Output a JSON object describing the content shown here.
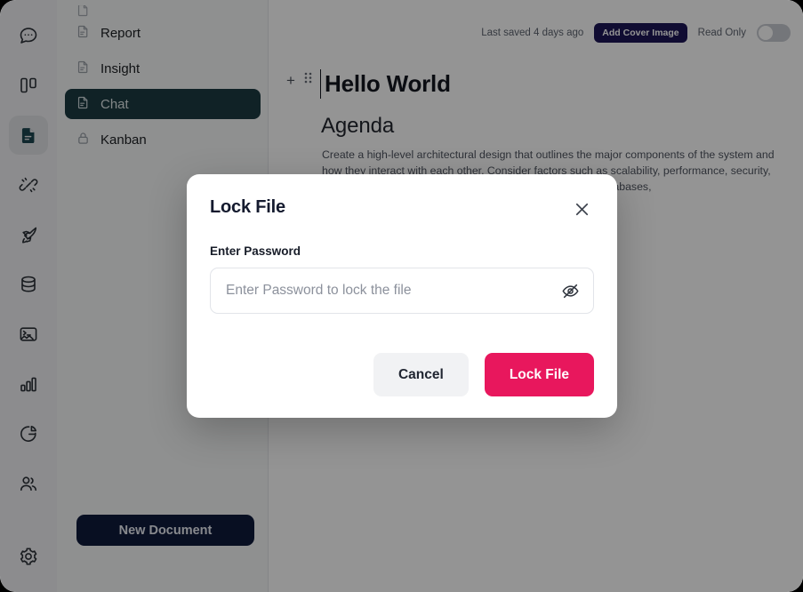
{
  "colors": {
    "accent_pink": "#E8175D",
    "sidebar_active_teal": "#1D3B43",
    "new_document_navy": "#0E1A3C",
    "add_cover_navy": "#1C1557",
    "rail_background": "#F1F2F4",
    "sidebar_background": "#F7F8F9"
  },
  "rail": {
    "items": [
      {
        "icon": "chat-bubble-icon",
        "active": false
      },
      {
        "icon": "columns-layout-icon",
        "active": false
      },
      {
        "icon": "document-icon",
        "active": true
      },
      {
        "icon": "plug-connection-icon",
        "active": false
      },
      {
        "icon": "rocket-icon",
        "active": false
      },
      {
        "icon": "database-icon",
        "active": false
      },
      {
        "icon": "terminal-image-icon",
        "active": false
      },
      {
        "icon": "bar-chart-icon",
        "active": false
      },
      {
        "icon": "pie-chart-icon",
        "active": false
      },
      {
        "icon": "users-icon",
        "active": false
      },
      {
        "icon": "gear-icon",
        "active": false
      }
    ]
  },
  "sidebar": {
    "items": [
      {
        "label": "Report",
        "icon": "document-icon",
        "active": false,
        "locked": false
      },
      {
        "label": "Insight",
        "icon": "document-icon",
        "active": false,
        "locked": false
      },
      {
        "label": "Chat",
        "icon": "document-icon",
        "active": true,
        "locked": false
      },
      {
        "label": "Kanban",
        "icon": "lock-icon",
        "active": false,
        "locked": true
      }
    ],
    "new_document_label": "New Document"
  },
  "editor": {
    "last_saved": "Last saved 4 days ago",
    "add_cover_label": "Add Cover Image",
    "read_only_label": "Read Only",
    "read_only_enabled": false,
    "add_block_label": "+",
    "title": "Hello World",
    "heading": "Agenda",
    "paragraph": "Create a high-level architectural design that outlines the major components of the system and how they interact with each other. Consider factors such as scalability, performance, security, and ect requirements and the chosen ages, frameworks, databases,"
  },
  "modal": {
    "title": "Lock File",
    "close_icon": "close-icon",
    "password_label": "Enter Password",
    "password_placeholder": "Enter Password to lock the file",
    "password_value": "",
    "visibility_icon": "eye-off-icon",
    "cancel_label": "Cancel",
    "confirm_label": "Lock File"
  }
}
